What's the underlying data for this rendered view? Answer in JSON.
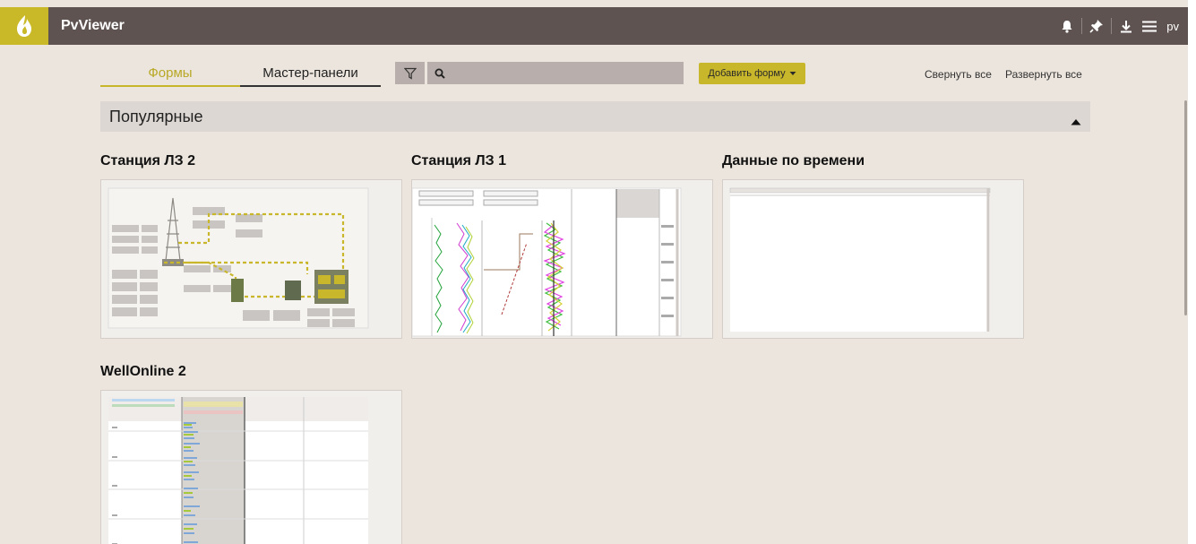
{
  "header": {
    "app_title": "PvViewer",
    "user": "pv",
    "icons": [
      "bell-icon",
      "pin-icon",
      "download-icon",
      "menu-icon"
    ]
  },
  "tabs": [
    {
      "label": "Формы",
      "active": true
    },
    {
      "label": "Мастер-панели",
      "active": false
    }
  ],
  "search": {
    "value": "",
    "placeholder": ""
  },
  "toolbar": {
    "add_form_label": "Добавить форму",
    "collapse_all": "Свернуть все",
    "expand_all": "Развернуть все"
  },
  "section": {
    "title": "Популярные",
    "expanded": true,
    "cards": [
      {
        "title": "Станция ЛЗ 2"
      },
      {
        "title": "Станция ЛЗ 1"
      },
      {
        "title": "Данные по времени"
      },
      {
        "title": "WellOnline 2"
      }
    ]
  },
  "colors": {
    "header_bg": "#5e5350",
    "accent": "#c8b72a",
    "page_bg": "#ece5dd",
    "section_bg": "#ddd7d3"
  }
}
